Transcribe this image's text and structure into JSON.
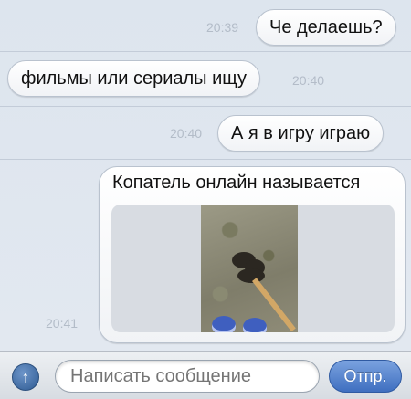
{
  "messages": [
    {
      "direction": "out",
      "text": "Че делаешь?",
      "time": "20:39"
    },
    {
      "direction": "in",
      "text": "фильмы или сериалы ищу",
      "time": "20:40"
    },
    {
      "direction": "out",
      "text": "А я в игру играю",
      "time": "20:40"
    },
    {
      "direction": "out",
      "text": "Копатель онлайн называется",
      "time": "20:41",
      "attachment": "photo"
    }
  ],
  "composer": {
    "placeholder": "Написать сообщение",
    "send_label": "Отпр.",
    "attach_icon": "arrow-up-icon"
  },
  "colors": {
    "background": "#dfe6ef",
    "bubble": "#ffffff",
    "send_button": "#4a78c6",
    "timestamp": "#b3bcc8"
  }
}
